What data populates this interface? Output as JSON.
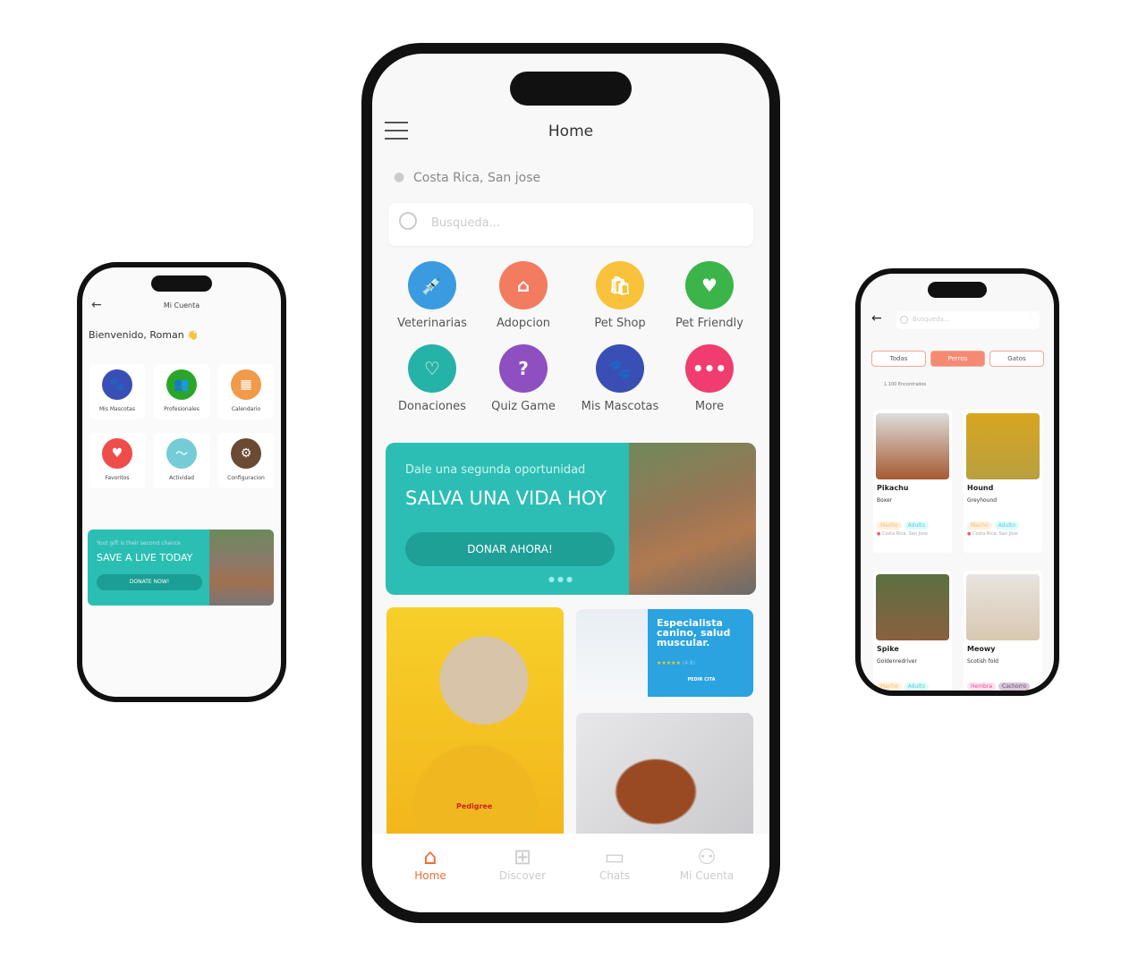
{
  "left": {
    "title": "Mi Cuenta",
    "welcome": "Bienvenido, Roman",
    "wave": "👋",
    "tiles": [
      {
        "label": "Mis Mascotas",
        "icon": "paw-icon",
        "color": "#3a4fb5",
        "glyph": "🐾"
      },
      {
        "label": "Profesionales",
        "icon": "people-icon",
        "color": "#2aa52a",
        "glyph": "👥"
      },
      {
        "label": "Calendario",
        "icon": "calendar-icon",
        "color": "#f09a4a",
        "glyph": "▦"
      },
      {
        "label": "Favoritos",
        "icon": "heart-icon",
        "color": "#ef4c4c",
        "glyph": "♥"
      },
      {
        "label": "Actividad",
        "icon": "pulse-icon",
        "color": "#76ccd6",
        "glyph": "〜"
      },
      {
        "label": "Configuracion",
        "icon": "gear-icon",
        "color": "#6a4a33",
        "glyph": "⚙"
      }
    ],
    "banner": {
      "subtitle": "Yout gift is their second chance",
      "title": "SAVE  A LIVE TODAY",
      "button": "DONATE NOW!"
    }
  },
  "center": {
    "title": "Home",
    "location": "Costa Rica, San jose",
    "search_placeholder": "Busqueda...",
    "categories": [
      {
        "label": "Veterinarias",
        "icon": "syringe-icon",
        "color": "#3a9be0",
        "glyph": "💉"
      },
      {
        "label": "Adopcion",
        "icon": "house-icon",
        "color": "#f37b60",
        "glyph": "⌂"
      },
      {
        "label": "Pet Shop",
        "icon": "shop-bag-icon",
        "color": "#f8c23a",
        "glyph": "🛍"
      },
      {
        "label": "Pet Friendly",
        "icon": "paw-heart-icon",
        "color": "#3bb44a",
        "glyph": "♥"
      },
      {
        "label": "Donaciones",
        "icon": "donation-hand-icon",
        "color": "#25b3a8",
        "glyph": "♡"
      },
      {
        "label": "Quiz Game",
        "icon": "quiz-icon",
        "color": "#8e4fc1",
        "glyph": "?"
      },
      {
        "label": "Mis Mascotas",
        "icon": "paw-icon",
        "color": "#3a4fb5",
        "glyph": "🐾"
      },
      {
        "label": "More",
        "icon": "more-dots-icon",
        "color": "#f03c6e",
        "glyph": "•••"
      }
    ],
    "banner": {
      "subtitle": "Dale una segunda oportunidad",
      "title": "SALVA UNA VIDA HOY",
      "button": "DONAR AHORA!"
    },
    "promo": {
      "title": "Especialista canino, salud muscular.",
      "stars": "★★★★★",
      "rating": "(4.8)",
      "button": "PEDIR CITA"
    },
    "food_brand": "Pedigree",
    "nav": [
      {
        "label": "Home",
        "icon": "home-icon",
        "active": true
      },
      {
        "label": "Discover",
        "icon": "grid-icon"
      },
      {
        "label": "Chats",
        "icon": "chat-icon"
      },
      {
        "label": "Mi Cuenta",
        "icon": "user-icon"
      }
    ],
    "accent": "#f36b3a"
  },
  "right": {
    "search_placeholder": "Busqueda...",
    "filters": [
      "Todas",
      "Perros",
      "Gatos"
    ],
    "active_filter": "Perros",
    "count": "1.100 Encontrados",
    "pets": [
      {
        "name": "Pikachu",
        "breed": "Boxer",
        "tags": [
          "Macho",
          "Adulto"
        ],
        "location": "Costa Rica, San Jose"
      },
      {
        "name": "Hound",
        "breed": "Greyhound",
        "tags": [
          "Macho",
          "Adulto"
        ],
        "location": "Costa Rica, San Jose"
      },
      {
        "name": "Spike",
        "breed": "Goldenredriver",
        "tags": [
          "Macho",
          "Adulto"
        ]
      },
      {
        "name": "Meowy",
        "breed": "Scotish fold",
        "tags": [
          "Hembra",
          "Cachorro"
        ]
      }
    ]
  }
}
